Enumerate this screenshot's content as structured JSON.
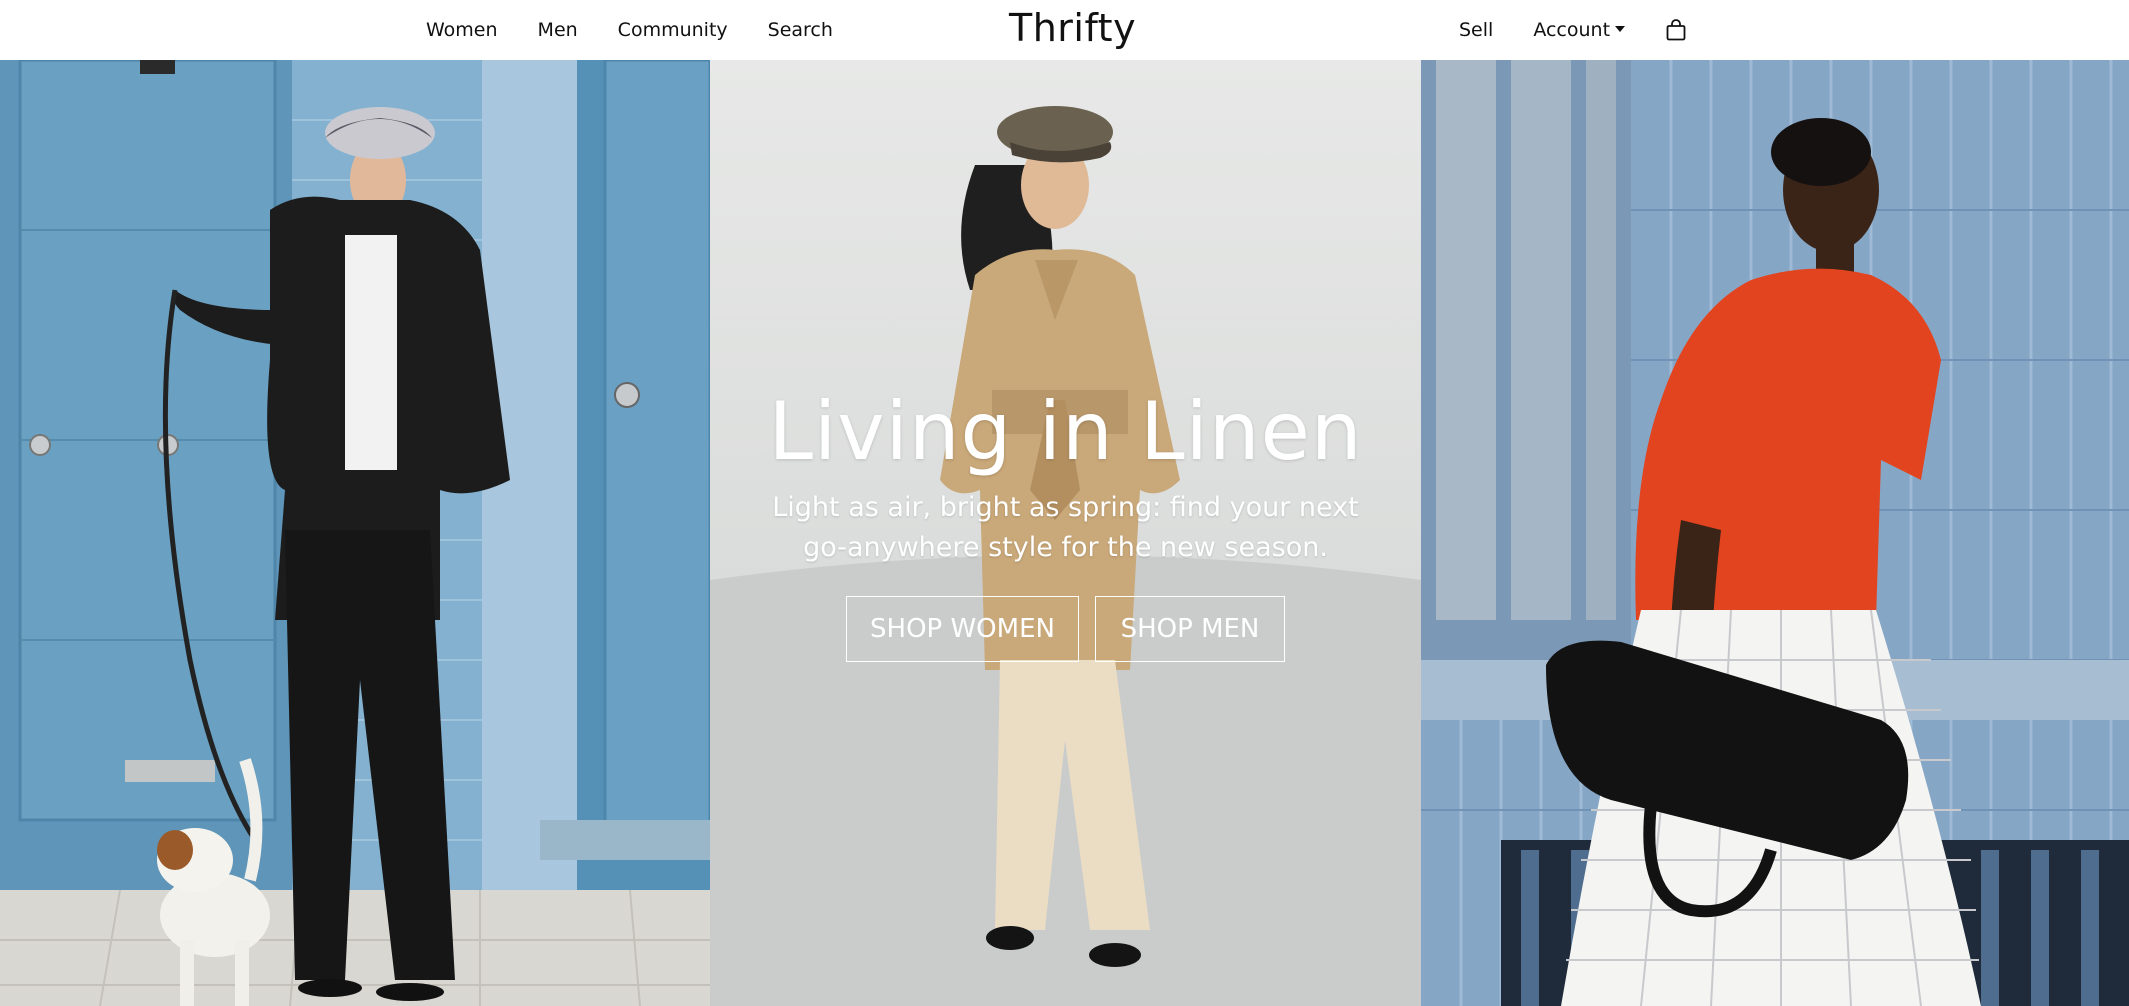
{
  "header": {
    "nav_left": [
      "Women",
      "Men",
      "Community",
      "Search"
    ],
    "logo": "Thrifty",
    "sell": "Sell",
    "account": "Account",
    "bag_icon": "shopping-bag-icon"
  },
  "hero": {
    "title": "Living in Linen",
    "subtitle": "Light as air, bright as spring: find your next go-anywhere style for the new season.",
    "shop_women": "SHOP WOMEN",
    "shop_men": "SHOP MEN"
  },
  "colors": {
    "header_bg": "#ffffff",
    "text": "#111111",
    "overlay_text": "#ffffff",
    "left_door_blue": "#5b93b5",
    "right_tile_blue": "#7fa2c4",
    "mid_wall": "#e6e7e6",
    "orange_tee": "#e2441f"
  }
}
